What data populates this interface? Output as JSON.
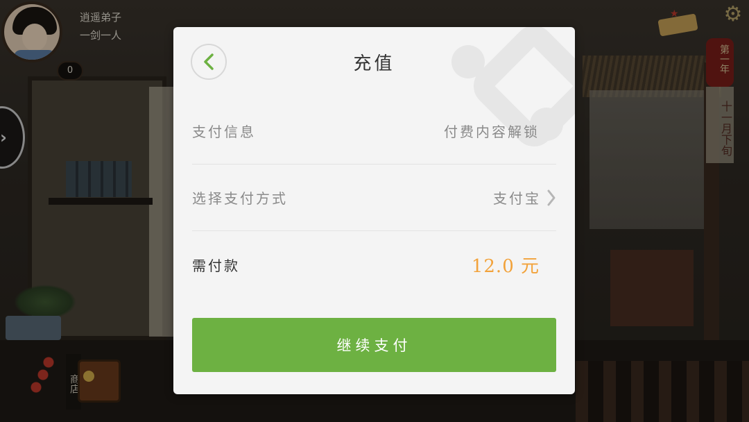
{
  "game": {
    "player_title": "逍遥弟子",
    "player_name": "一剑一人",
    "level": "0",
    "calendar_banner": "第一年",
    "calendar_date": "十一月下旬",
    "shop_label": "商店"
  },
  "dialog": {
    "title": "充值",
    "rows": [
      {
        "label": "支付信息",
        "value": "付费内容解锁"
      },
      {
        "label": "选择支付方式",
        "value": "支付宝"
      },
      {
        "label": "需付款",
        "value": "12.0 元"
      }
    ],
    "pay_button_label": "继续支付",
    "colors": {
      "accent_green": "#6db142",
      "amount_orange": "#f2a23a"
    },
    "icons": [
      "back-chevron-icon",
      "chevron-right-icon",
      "watermark-logo-icon"
    ]
  }
}
